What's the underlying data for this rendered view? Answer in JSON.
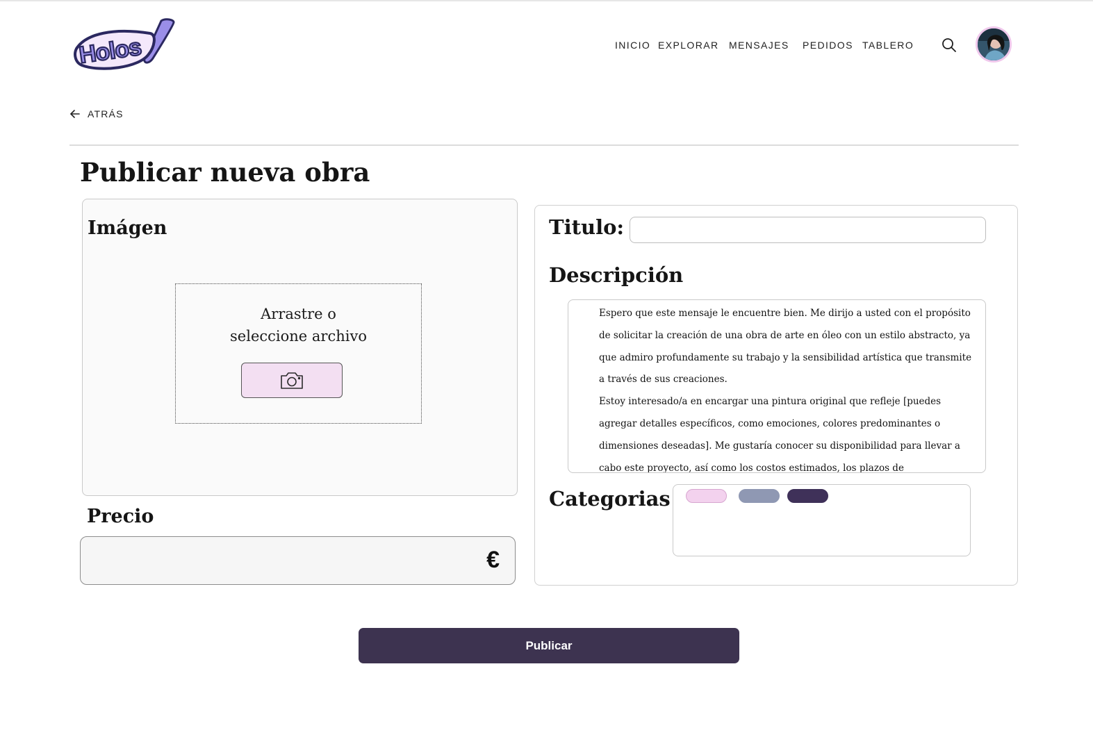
{
  "app": {
    "logo_text": "Holos",
    "brand_colors": {
      "primary": "#3d3350",
      "logo_fill": "#9a8ee8",
      "logo_outline": "#2b2860",
      "pink_accent": "#f3dff2"
    }
  },
  "header": {
    "nav": [
      {
        "label": "INICIO"
      },
      {
        "label": "EXPLORAR"
      },
      {
        "label": "MENSAJES"
      },
      {
        "label": "PEDIDOS"
      },
      {
        "label": "TABLERO"
      }
    ],
    "search_icon": "search-icon",
    "avatar_icon": "user-avatar"
  },
  "back": {
    "label": "ATRÁS",
    "icon": "arrow-left-icon"
  },
  "page_title": "Publicar nueva obra",
  "image_section": {
    "title": "Imágen",
    "drop_text_line1": "Arrastre o",
    "drop_text_line2": "seleccione archivo",
    "upload_icon": "camera-icon"
  },
  "price_section": {
    "label": "Precio",
    "value": "",
    "currency_symbol": "€"
  },
  "form": {
    "title_label": "Titulo:",
    "title_value": "",
    "description_label": "Descripción",
    "description_paragraphs": [
      "Espero que este mensaje le encuentre bien. Me dirijo a usted con el propósito de solicitar la creación de una obra de arte en óleo con un estilo abstracto, ya que admiro profundamente su trabajo y la sensibilidad artística que transmite a través de sus creaciones.",
      "Estoy interesado/a en encargar una pintura original que refleje [puedes agregar detalles específicos, como emociones, colores predominantes o dimensiones deseadas]. Me gustaría conocer su disponibilidad para llevar a cabo este proyecto, así como los costos estimados, los plazos de"
    ],
    "categories_label": "Categorias",
    "category_chips": [
      {
        "color": "#f3d2ee",
        "border": "#d7a6d0"
      },
      {
        "color": "#8f98b3",
        "border": "#8f98b3"
      },
      {
        "color": "#3f3159",
        "border": "#3f3159"
      }
    ]
  },
  "submit": {
    "label": "Publicar"
  }
}
